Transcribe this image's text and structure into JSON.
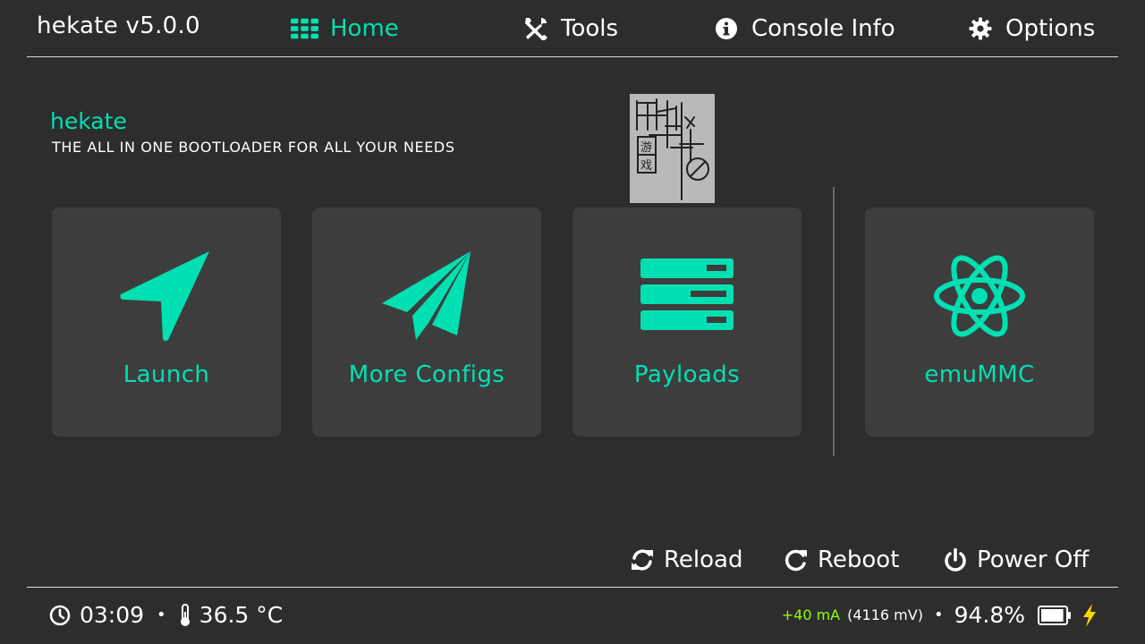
{
  "header": {
    "app_title": "hekate v5.0.0",
    "tabs": [
      {
        "label": "Home",
        "icon": "grid-icon",
        "active": true
      },
      {
        "label": "Tools",
        "icon": "tools-icon",
        "active": false
      },
      {
        "label": "Console Info",
        "icon": "info-icon",
        "active": false
      },
      {
        "label": "Options",
        "icon": "gear-icon",
        "active": false
      }
    ]
  },
  "brand": {
    "name": "hekate",
    "tagline": "THE ALL IN ONE BOOTLOADER FOR ALL YOUR NEEDS"
  },
  "cards": [
    {
      "label": "Launch",
      "icon": "location-arrow-icon"
    },
    {
      "label": "More Configs",
      "icon": "paper-plane-icon"
    },
    {
      "label": "Payloads",
      "icon": "server-stack-icon"
    },
    {
      "label": "emuMMC",
      "icon": "atom-icon"
    }
  ],
  "actions": [
    {
      "label": "Reload",
      "icon": "reload-icon"
    },
    {
      "label": "Reboot",
      "icon": "redo-icon"
    },
    {
      "label": "Power Off",
      "icon": "power-icon"
    }
  ],
  "footer": {
    "time": "03:09",
    "temperature": "36.5 °C",
    "separator": "•",
    "current": "+40 mA",
    "voltage": "(4116 mV)",
    "battery_percent": "94.8%",
    "battery_level": 0.948,
    "charging": true
  },
  "colors": {
    "accent": "#00e0b2",
    "background": "#2d2d2d",
    "card": "#3d3d3d",
    "current": "#96ff00",
    "bolt": "#ffd500"
  }
}
